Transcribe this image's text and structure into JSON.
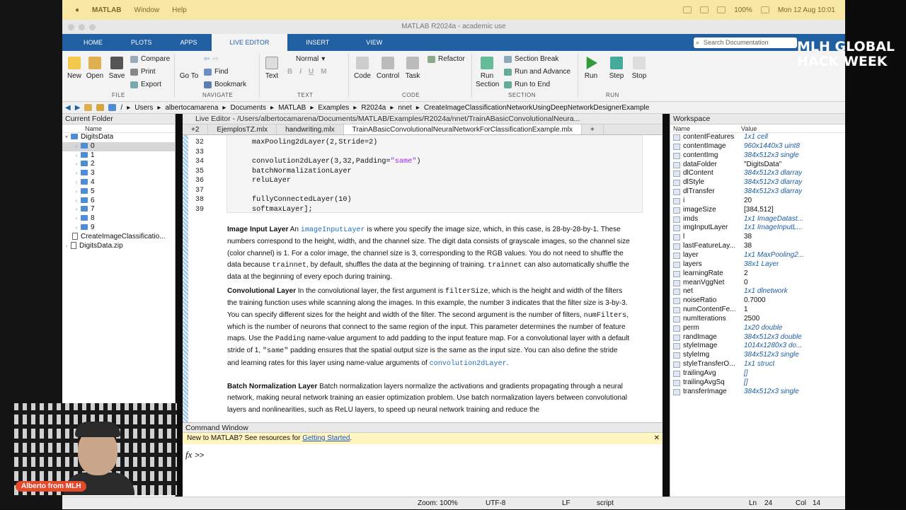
{
  "macbar": {
    "app": "MATLAB",
    "menu_window": "Window",
    "menu_help": "Help",
    "battery": "100%",
    "datetime": "Mon 12 Aug  10:01"
  },
  "window_title": "MATLAB R2024a - academic use",
  "tabs": [
    "HOME",
    "PLOTS",
    "APPS",
    "LIVE EDITOR",
    "INSERT",
    "VIEW"
  ],
  "search_placeholder": "Search Documentation",
  "toolstrip": {
    "file": {
      "new": "New",
      "open": "Open",
      "save": "Save",
      "compare": "Compare",
      "print": "Print",
      "export": "Export",
      "section": "FILE"
    },
    "navigate": {
      "goto": "Go To",
      "find": "Find",
      "bookmark": "Bookmark",
      "section": "NAVIGATE"
    },
    "text": {
      "text": "Text",
      "style": "Normal",
      "bold": "B",
      "italic": "I",
      "underline": "U",
      "mono": "M",
      "section": "TEXT"
    },
    "code": {
      "code": "Code",
      "control": "Control",
      "task": "Task",
      "refactor": "Refactor",
      "section": "CODE"
    },
    "section": {
      "run_section": "Run Section",
      "section_break": "Section Break",
      "run_advance": "Run and Advance",
      "run_end": "Run to End",
      "section": "SECTION"
    },
    "run": {
      "run": "Run",
      "step": "Step",
      "stop": "Stop",
      "section": "RUN"
    }
  },
  "address": [
    "/",
    "Users",
    "albertocamarena",
    "Documents",
    "MATLAB",
    "Examples",
    "R2024a",
    "nnet",
    "CreateImageClassificationNetworkUsingDeepNetworkDesignerExample"
  ],
  "current_folder": {
    "title": "Current Folder",
    "col": "Name",
    "root": "DigitsData",
    "items": [
      "0",
      "1",
      "2",
      "3",
      "4",
      "5",
      "6",
      "7",
      "8",
      "9"
    ],
    "files": [
      "CreateImageClassificatio...",
      "DigitsData.zip"
    ]
  },
  "editor": {
    "title": "Live Editor - /Users/albertocamarena/Documents/MATLAB/Examples/R2024a/nnet/TrainABasicConvolutionalNeura...",
    "more_tabs": "+2",
    "tabs": [
      "EjemplosTZ.mlx",
      "handwriting.mlx",
      "TrainABasicConvolutionalNeuralNetworkForClassificationExample.mlx"
    ],
    "add_tab": "+",
    "line_numbers": [
      "32",
      "33",
      "34",
      "35",
      "36",
      "37",
      "38",
      "39"
    ],
    "code": {
      "l32": "maxPooling2dLayer(2,Stride=2)",
      "l34a": "convolution2dLayer(3,32,Padding=",
      "l34s": "\"same\"",
      "l34b": ")",
      "l35": "batchNormalizationLayer",
      "l36": "reluLayer",
      "l38": "fullyConnectedLayer(10)",
      "l39": "softmaxLayer];"
    },
    "p1": {
      "head": "Image Input Layer",
      "a": " An ",
      "code1": "imageInputLayer",
      "b": " is where you specify the image size, which, in this case, is 28-by-28-by-1. These numbers correspond to the height, width, and the channel size. The digit data consists of grayscale images, so the channel size (color channel) is 1. For a color image, the channel size is 3, corresponding to the RGB values. You do not need to shuffle the data because ",
      "code2": "trainnet",
      "c": ", by default, shuffles the data at the beginning of training. ",
      "code3": "trainnet",
      "d": " can also automatically shuffle the data at the beginning of every epoch during training."
    },
    "p2": {
      "head": "Convolutional Layer",
      "a": " In the convolutional layer, the first argument is ",
      "code1": "filterSize",
      "b": ", which is the height and width of the filters the training function uses while scanning along the images. In this example, the number 3 indicates that the filter size is 3-by-3. You can specify different sizes for the height and width of the filter. The second argument is the number of filters, ",
      "code2": "numFilters",
      "c": ", which is the number of neurons that connect to the same region of the input. This parameter determines the number of feature maps. Use the ",
      "code3": "Padding",
      "d": " name-value argument to add padding to the input feature map. For a convolutional layer with a default stride of 1, ",
      "code4": "\"same\"",
      "e": " padding ensures that the spatial output size is the same as the input size. You can also define the stride and learning rates for this layer using name-value arguments of ",
      "code5": "convolution2dLayer",
      "f": "."
    },
    "p3": {
      "head": "Batch Normalization Layer",
      "a": " Batch normalization layers normalize the activations and gradients propagating through a neural network, making neural network training an easier optimization problem. Use batch normalization layers between convolutional layers and nonlinearities, such as ReLU layers, to speed up neural network training and reduce the"
    }
  },
  "command_window": {
    "title": "Command Window",
    "banner": "New to MATLAB? See resources for ",
    "banner_link": "Getting Started",
    "banner_end": ".",
    "fx": "fx",
    "prompt": ">>"
  },
  "workspace": {
    "title": "Workspace",
    "col_name": "Name",
    "col_value": "Value",
    "vars": [
      {
        "n": "contentFeatures",
        "v": "1x1 cell",
        "i": true
      },
      {
        "n": "contentImage",
        "v": "960x1440x3 uint8",
        "i": true
      },
      {
        "n": "contentImg",
        "v": "384x512x3 single",
        "i": true
      },
      {
        "n": "dataFolder",
        "v": "\"DigitsData\"",
        "i": false
      },
      {
        "n": "dlContent",
        "v": "384x512x3 dlarray",
        "i": true
      },
      {
        "n": "dlStyle",
        "v": "384x512x3 dlarray",
        "i": true
      },
      {
        "n": "dlTransfer",
        "v": "384x512x3 dlarray",
        "i": true
      },
      {
        "n": "i",
        "v": "20",
        "i": false
      },
      {
        "n": "imageSize",
        "v": "[384,512]",
        "i": false
      },
      {
        "n": "imds",
        "v": "1x1 ImageDatast...",
        "i": true
      },
      {
        "n": "imgInputLayer",
        "v": "1x1 ImageInputL...",
        "i": true
      },
      {
        "n": "l",
        "v": "38",
        "i": false
      },
      {
        "n": "lastFeatureLay...",
        "v": "38",
        "i": false
      },
      {
        "n": "layer",
        "v": "1x1 MaxPooling2...",
        "i": true
      },
      {
        "n": "layers",
        "v": "38x1 Layer",
        "i": true
      },
      {
        "n": "learningRate",
        "v": "2",
        "i": false
      },
      {
        "n": "meanVggNet",
        "v": "0",
        "i": false
      },
      {
        "n": "net",
        "v": "1x1 dlnetwork",
        "i": true
      },
      {
        "n": "noiseRatio",
        "v": "0.7000",
        "i": false
      },
      {
        "n": "numContentFe...",
        "v": "1",
        "i": false
      },
      {
        "n": "numIterations",
        "v": "2500",
        "i": false
      },
      {
        "n": "perm",
        "v": "1x20 double",
        "i": true
      },
      {
        "n": "randImage",
        "v": "384x512x3 double",
        "i": true
      },
      {
        "n": "styleImage",
        "v": "1014x1280x3 do...",
        "i": true
      },
      {
        "n": "styleImg",
        "v": "384x512x3 single",
        "i": true
      },
      {
        "n": "styleTransferO...",
        "v": "1x1 struct",
        "i": true
      },
      {
        "n": "trailingAvg",
        "v": "[]",
        "i": true
      },
      {
        "n": "trailingAvgSq",
        "v": "[]",
        "i": true
      },
      {
        "n": "transferImage",
        "v": "384x512x3 single",
        "i": true
      }
    ]
  },
  "status": {
    "zoom": "Zoom: 100%",
    "encoding": "UTF-8",
    "eol": "LF",
    "mode": "script",
    "ln": "Ln",
    "ln_val": "24",
    "col": "Col",
    "col_val": "14"
  },
  "overlay": {
    "brand_line1": "MLH GLOBAL",
    "brand_line2": "HACK WEEK",
    "presenter": "Alberto from MLH"
  },
  "colors": {
    "accent": "#1f5fa2",
    "banner": "#fff5c0",
    "badge": "#e5492c"
  }
}
